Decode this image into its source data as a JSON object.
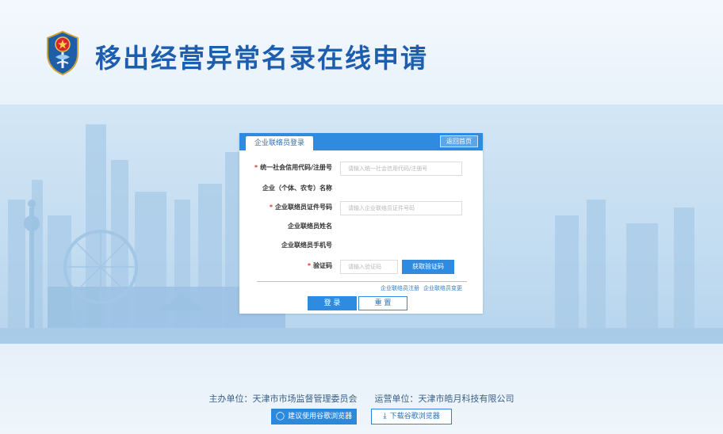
{
  "header": {
    "title": "移出经营异常名录在线申请",
    "emblem_icon": "emblem-icon"
  },
  "login": {
    "tab_label": "企业联络员登录",
    "back_button": "返回首页",
    "fields": [
      {
        "label": "统一社会信用代码/注册号",
        "required": true,
        "placeholder": "请输入统一社会信用代码/注册号",
        "type": "input"
      },
      {
        "label": "企业（个体、农专）名称",
        "required": false,
        "type": "text"
      },
      {
        "label": "企业联络员证件号码",
        "required": true,
        "placeholder": "请输入企业联络员证件号码",
        "type": "input"
      },
      {
        "label": "企业联络员姓名",
        "required": false,
        "type": "text"
      },
      {
        "label": "企业联络员手机号",
        "required": false,
        "type": "text"
      },
      {
        "label": "验证码",
        "required": true,
        "placeholder": "请输入验证码",
        "type": "captcha",
        "button": "获取验证码"
      }
    ],
    "link_register": "企业联络员注册",
    "link_change": "企业联络员变更",
    "submit_label": "登 录",
    "reset_label": "重 置"
  },
  "footer": {
    "sponsor": "主办单位：天津市市场监督管理委员会",
    "operator": "运营单位：天津市皓月科技有限公司",
    "browser_tip": "建议使用谷歌浏览器",
    "download_browser": "下载谷歌浏览器"
  },
  "colors": {
    "primary": "#2f8be0",
    "title": "#1d5fae",
    "required": "#e0322c"
  }
}
